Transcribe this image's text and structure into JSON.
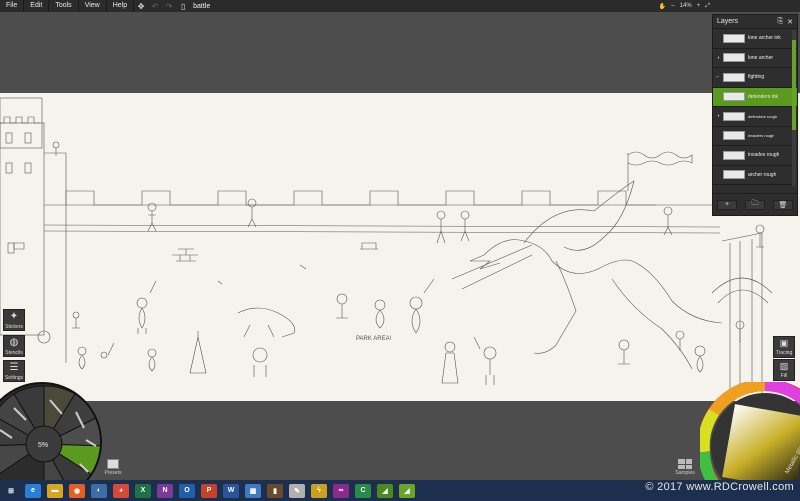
{
  "menubar": {
    "file": "File",
    "edit": "Edit",
    "tools": "Tools",
    "view": "View",
    "help": "Help",
    "doc_title": "battle",
    "zoom": "14%",
    "zoom_minus": "–",
    "zoom_plus": "+"
  },
  "layers": {
    "title": "Layers",
    "items": [
      {
        "label": "lone archer ink"
      },
      {
        "label": "lone archer"
      },
      {
        "label": "fighting"
      },
      {
        "label": "defenders ink"
      },
      {
        "label": "defenders rough"
      },
      {
        "label": "invaders rough"
      },
      {
        "label": "invades rough"
      },
      {
        "label": "archer rough"
      }
    ],
    "add": "+",
    "folder": "🗀",
    "delete": "🗑"
  },
  "sidebar": {
    "stickers": "Stickers",
    "stencils": "Stencils",
    "settings": "Settings"
  },
  "right": {
    "tracing": "Tracing",
    "fill": "Fill"
  },
  "toolwheel": {
    "size": "5%"
  },
  "color": {
    "metallic": "Metallic 0%",
    "accent": "#5a9a1e"
  },
  "presets_label": "Presets",
  "samples_label": "Samples",
  "sketch_text": "PARK AREA!",
  "watermark": "© 2017 www.RDCrowell.com",
  "taskbar": {
    "apps": [
      {
        "icon": "windows-icon",
        "label": "⊞",
        "color": "#1d2f4f"
      },
      {
        "icon": "ie-icon",
        "label": "e",
        "color": "#2a7fd4"
      },
      {
        "icon": "file-explorer-icon",
        "label": "▬",
        "color": "#d9a520"
      },
      {
        "icon": "firefox-icon",
        "label": "◉",
        "color": "#e2601d"
      },
      {
        "icon": "chrome-app-icon",
        "label": "◐",
        "color": "#3a6ea5"
      },
      {
        "icon": "chrome-icon",
        "label": "◕",
        "color": "#d84a38"
      },
      {
        "icon": "excel-icon",
        "label": "X",
        "color": "#1f7244"
      },
      {
        "icon": "onenote-icon",
        "label": "N",
        "color": "#7a3a9a"
      },
      {
        "icon": "outlook-icon",
        "label": "O",
        "color": "#1e5fa8"
      },
      {
        "icon": "powerpoint-icon",
        "label": "P",
        "color": "#c4412a"
      },
      {
        "icon": "word-icon",
        "label": "W",
        "color": "#2a5699"
      },
      {
        "icon": "network-icon",
        "label": "▦",
        "color": "#3f7ac0"
      },
      {
        "icon": "books-icon",
        "label": "▮",
        "color": "#6a4a2a"
      },
      {
        "icon": "sketch-app-icon",
        "label": "✎",
        "color": "#b0b0b0"
      },
      {
        "icon": "lightning-icon",
        "label": "ϟ",
        "color": "#c9a020"
      },
      {
        "icon": "creative-cloud-icon",
        "label": "∞",
        "color": "#8a2a8a"
      },
      {
        "icon": "cam-icon",
        "label": "C",
        "color": "#2a8a4a"
      },
      {
        "icon": "artrage-icon",
        "label": "◢",
        "color": "#4d8a1e"
      },
      {
        "icon": "artrage-active-icon",
        "label": "◢",
        "color": "#6aa52a"
      }
    ]
  }
}
